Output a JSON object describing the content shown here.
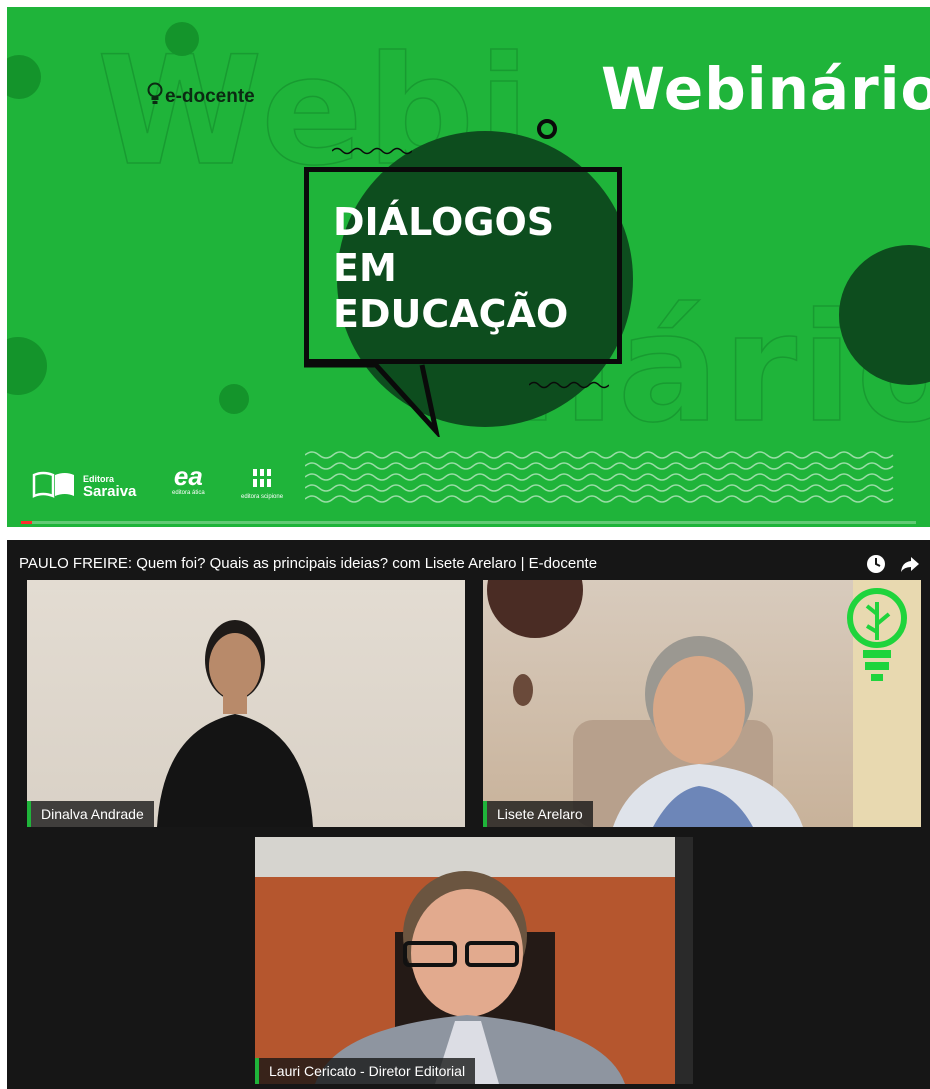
{
  "webinar": {
    "brand": "e-docente",
    "label": "Webinário",
    "title_lines": [
      "DIÁLOGOS",
      "EM",
      "EDUCAÇÃO"
    ],
    "publishers": {
      "saraiva_top": "Editora",
      "saraiva_name": "Saraiva",
      "atica_mark": "ea",
      "atica_name": "editora ática",
      "scipione_name": "editora scipione"
    },
    "progress": 0.012
  },
  "call": {
    "video_title": "PAULO FREIRE: Quem foi? Quais as principais ideias? com Lisete Arelaro | E-docente",
    "participants": [
      {
        "name": "Dinalva Andrade"
      },
      {
        "name": "Lisete Arelaro"
      },
      {
        "name": "Lauri Cericato - Diretor Editorial"
      }
    ]
  },
  "icons": [
    "lightbulb-icon",
    "clock-icon",
    "share-icon",
    "open-book-icon"
  ],
  "colors": {
    "brand_green": "#1fb43a",
    "dark_green": "#0d4d1e",
    "call_background": "#161616"
  }
}
